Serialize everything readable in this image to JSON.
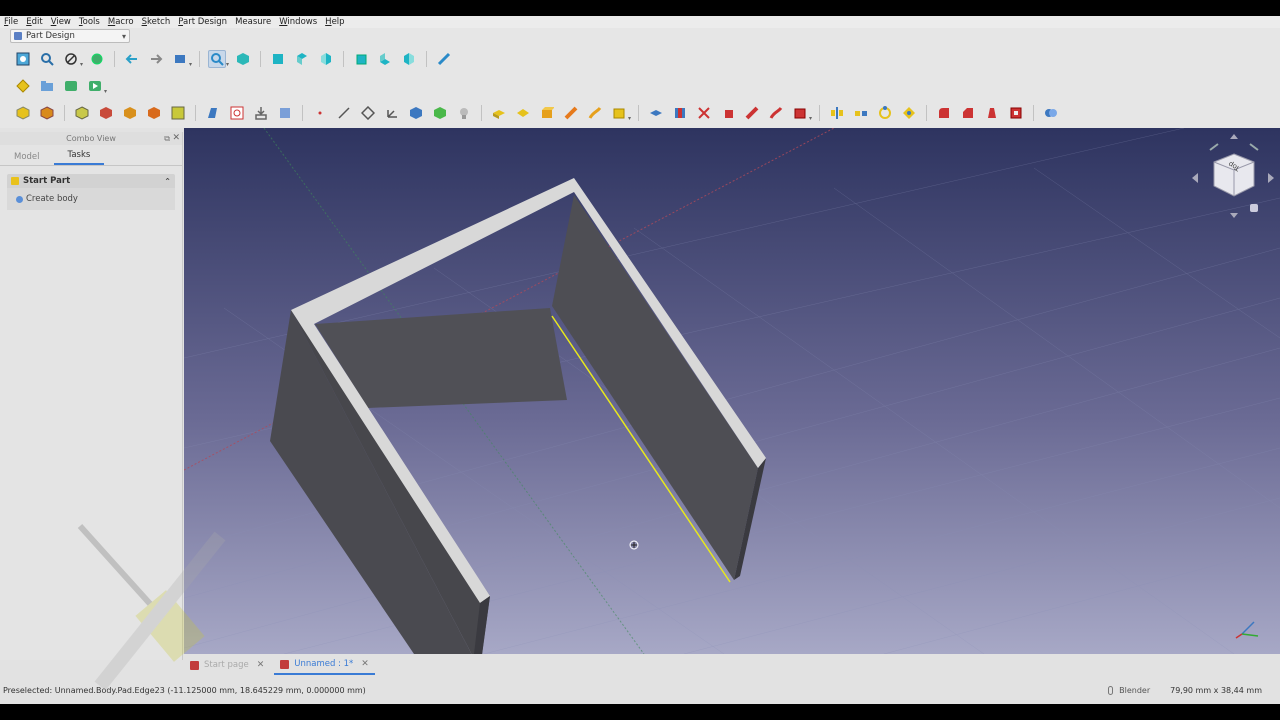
{
  "menubar": {
    "items": [
      {
        "u": "F",
        "rest": "ile"
      },
      {
        "u": "E",
        "rest": "dit"
      },
      {
        "u": "V",
        "rest": "iew"
      },
      {
        "u": "T",
        "rest": "ools"
      },
      {
        "u": "M",
        "rest": "acro"
      },
      {
        "u": "S",
        "rest": "ketch"
      },
      {
        "u": "P",
        "rest": "art Design"
      },
      {
        "u": "",
        "rest": "Measure"
      },
      {
        "u": "W",
        "rest": "indows"
      },
      {
        "u": "H",
        "rest": "elp"
      }
    ]
  },
  "workbench": {
    "selected": "Part Design"
  },
  "combo_view": {
    "title": "Combo View",
    "tabs": [
      {
        "label": "Model",
        "active": false
      },
      {
        "label": "Tasks",
        "active": true
      }
    ],
    "task_panel": {
      "header": "Start Part",
      "action": "Create body"
    }
  },
  "document_tabs": [
    {
      "label": "Start page",
      "active": false
    },
    {
      "label": "Unnamed : 1*",
      "active": true
    }
  ],
  "status": {
    "message": "Preselected: Unnamed.Body.Pad.Edge23 (-11.125000 mm, 18.645229 mm, 0.000000 mm)",
    "navigation_style": "Blender",
    "dimensions": "79,90 mm x 38,44 mm"
  },
  "navcube": {
    "face_label": "Top"
  },
  "colors": {
    "viewport_top": "#2e3460",
    "viewport_bottom": "#a7a8c6",
    "face_dark": "#4e4e54",
    "face_top": "#d8d8d8",
    "preselect_edge": "#e8e81c",
    "accent": "#3a7bd5"
  },
  "toolbar_icons": {
    "row1": [
      "view-fit-all-icon",
      "view-fit-selection-icon",
      "draw-style-icon",
      "bounding-box-icon",
      "back-icon",
      "forward-icon",
      "std-view-icon",
      "sync-view-icon",
      "isometric-icon",
      "front-view-icon",
      "top-view-icon",
      "right-view-icon",
      "rear-view-icon",
      "bottom-view-icon",
      "left-view-icon",
      "measure-icon"
    ],
    "row2": [
      "macro-record-icon",
      "macro-folder-icon",
      "macro-editor-icon",
      "macro-run-icon"
    ],
    "row3": [
      "create-body-icon",
      "create-part-icon",
      "datum-icons",
      "sketch-icon",
      "pad-icon",
      "pocket-icon",
      "revolution-icon",
      "fillet-icon",
      "boolean-icon"
    ]
  }
}
